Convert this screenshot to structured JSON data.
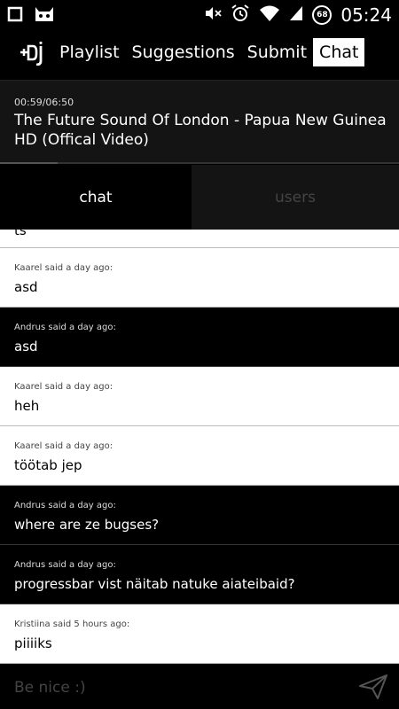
{
  "status_bar": {
    "time": "05:24",
    "battery_level": "68",
    "icons": [
      "square-icon",
      "android-cat-icon",
      "mute-icon",
      "alarm-icon",
      "wifi-icon",
      "signal-icon",
      "battery-icon"
    ]
  },
  "nav": {
    "logo_text": "+dj",
    "tabs": [
      {
        "label": "Playlist",
        "active": false
      },
      {
        "label": "Suggestions",
        "active": false
      },
      {
        "label": "Submit",
        "active": false
      },
      {
        "label": "Chat",
        "active": true
      }
    ]
  },
  "now_playing": {
    "time": "00:59/06:50",
    "title": "The Future Sound Of London - Papua New Guinea HD (Offical Video)",
    "progress": 0.144
  },
  "subtabs": {
    "chat": "chat",
    "users": "users"
  },
  "messages": [
    {
      "meta": "",
      "text": "ts",
      "theme": "light",
      "partial": true
    },
    {
      "meta": "Kaarel said a day ago:",
      "text": "asd",
      "theme": "light"
    },
    {
      "meta": "Andrus said a day ago:",
      "text": "asd",
      "theme": "dark"
    },
    {
      "meta": "Kaarel said a day ago:",
      "text": "heh",
      "theme": "light"
    },
    {
      "meta": "Kaarel said a day ago:",
      "text": "töötab jep",
      "theme": "light"
    },
    {
      "meta": "Andrus said a day ago:",
      "text": "where are ze bugses?",
      "theme": "dark"
    },
    {
      "meta": "Andrus said a day ago:",
      "text": "progressbar vist näitab natuke aiateibaid?",
      "theme": "dark"
    },
    {
      "meta": "Kristiina said 5 hours ago:",
      "text": "piiiiks",
      "theme": "light"
    }
  ],
  "input": {
    "placeholder": "Be nice :)",
    "value": ""
  },
  "colors": {
    "background": "#000000",
    "panel": "#141414",
    "light_row": "#ffffff",
    "muted": "#444444"
  }
}
